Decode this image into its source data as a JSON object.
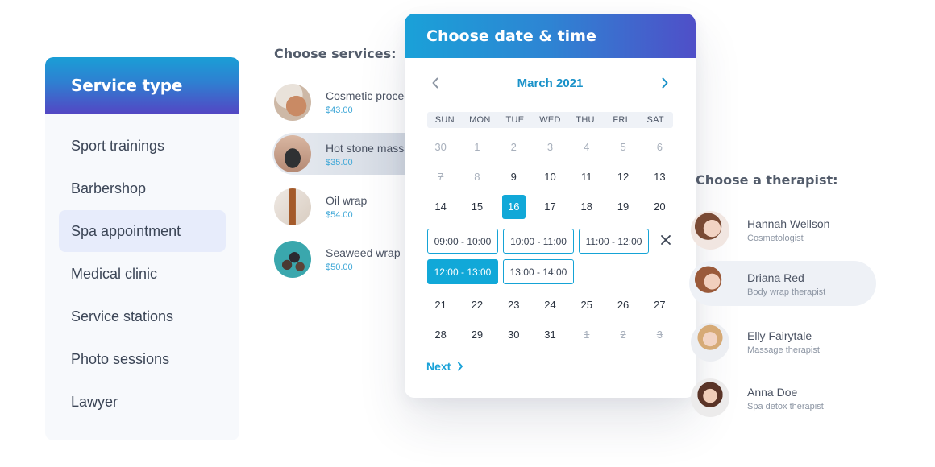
{
  "service_type": {
    "title": "Service type",
    "items": [
      {
        "label": "Sport trainings",
        "active": false
      },
      {
        "label": "Barbershop",
        "active": false
      },
      {
        "label": "Spa appointment",
        "active": true
      },
      {
        "label": "Medical clinic",
        "active": false
      },
      {
        "label": "Service stations",
        "active": false
      },
      {
        "label": "Photo sessions",
        "active": false
      },
      {
        "label": "Lawyer",
        "active": false
      }
    ]
  },
  "services": {
    "title": "Choose services:",
    "items": [
      {
        "name": "Cosmetic procedure",
        "price": "$43.00",
        "icon": "cosmetic-photo",
        "active": false
      },
      {
        "name": "Hot stone massage",
        "price": "$35.00",
        "icon": "hot-stone-photo",
        "active": true
      },
      {
        "name": "Oil wrap",
        "price": "$54.00",
        "icon": "oil-bottle-photo",
        "active": false
      },
      {
        "name": "Seaweed wrap",
        "price": "$50.00",
        "icon": "seaweed-photo",
        "active": false
      }
    ]
  },
  "calendar": {
    "title": "Choose date & time",
    "month_label": "March 2021",
    "prev_icon": "chevron-left-icon",
    "next_icon": "chevron-right-icon",
    "weekdays": [
      "SUN",
      "MON",
      "TUE",
      "WED",
      "THU",
      "FRI",
      "SAT"
    ],
    "weeks_top": [
      [
        {
          "d": "30",
          "s": "disabled"
        },
        {
          "d": "1",
          "s": "disabled"
        },
        {
          "d": "2",
          "s": "disabled"
        },
        {
          "d": "3",
          "s": "disabled"
        },
        {
          "d": "4",
          "s": "disabled"
        },
        {
          "d": "5",
          "s": "disabled"
        },
        {
          "d": "6",
          "s": "disabled"
        }
      ],
      [
        {
          "d": "7",
          "s": "disabled"
        },
        {
          "d": "8",
          "s": "muted"
        },
        {
          "d": "9",
          "s": ""
        },
        {
          "d": "10",
          "s": ""
        },
        {
          "d": "11",
          "s": ""
        },
        {
          "d": "12",
          "s": ""
        },
        {
          "d": "13",
          "s": ""
        }
      ],
      [
        {
          "d": "14",
          "s": ""
        },
        {
          "d": "15",
          "s": ""
        },
        {
          "d": "16",
          "s": "selected"
        },
        {
          "d": "17",
          "s": ""
        },
        {
          "d": "18",
          "s": ""
        },
        {
          "d": "19",
          "s": ""
        },
        {
          "d": "20",
          "s": ""
        }
      ]
    ],
    "weeks_bottom": [
      [
        {
          "d": "21",
          "s": ""
        },
        {
          "d": "22",
          "s": ""
        },
        {
          "d": "23",
          "s": ""
        },
        {
          "d": "24",
          "s": ""
        },
        {
          "d": "25",
          "s": ""
        },
        {
          "d": "26",
          "s": ""
        },
        {
          "d": "27",
          "s": ""
        }
      ],
      [
        {
          "d": "28",
          "s": ""
        },
        {
          "d": "29",
          "s": ""
        },
        {
          "d": "30",
          "s": ""
        },
        {
          "d": "31",
          "s": ""
        },
        {
          "d": "1",
          "s": "disabled"
        },
        {
          "d": "2",
          "s": "disabled"
        },
        {
          "d": "3",
          "s": "disabled"
        }
      ]
    ],
    "selected_date": "16",
    "time_slots": [
      {
        "label": "09:00 - 10:00",
        "selected": false
      },
      {
        "label": "10:00 - 11:00",
        "selected": false
      },
      {
        "label": "11:00 - 12:00",
        "selected": false
      },
      {
        "label": "12:00 - 13:00",
        "selected": true
      },
      {
        "label": "13:00 - 14:00",
        "selected": false
      }
    ],
    "close_icon": "close-icon",
    "next_label": "Next"
  },
  "therapists": {
    "title": "Choose a therapist:",
    "items": [
      {
        "name": "Hannah Wellson",
        "role": "Cosmetologist",
        "active": false
      },
      {
        "name": "Driana Red",
        "role": "Body wrap therapist",
        "active": true
      },
      {
        "name": "Elly Fairytale",
        "role": "Massage therapist",
        "active": false
      },
      {
        "name": "Anna Doe",
        "role": "Spa detox therapist",
        "active": false
      }
    ]
  },
  "colors": {
    "accent": "#11a8d8",
    "gradient_start": "#1aa1d8",
    "gradient_end": "#4f4fc8",
    "active_item_bg": "#e7ecfb"
  }
}
